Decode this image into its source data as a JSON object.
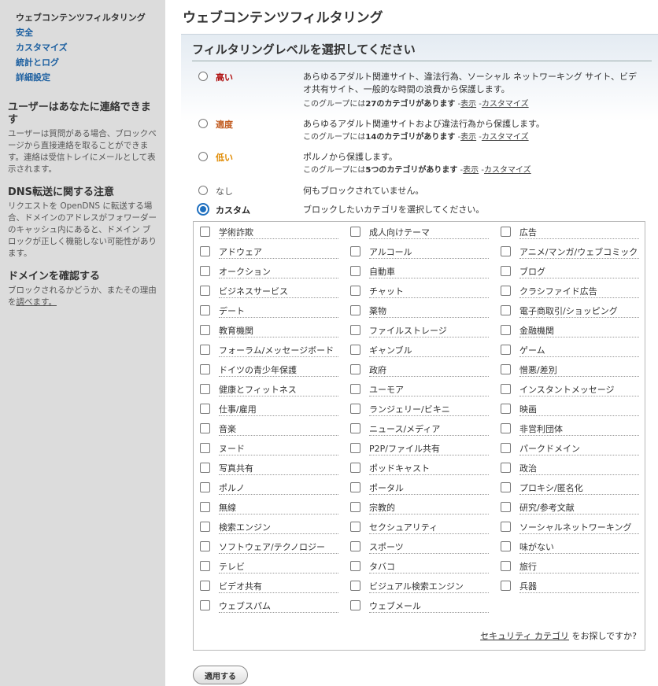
{
  "nav": {
    "items": [
      "ウェブコンテンツフィルタリング",
      "安全",
      "カスタマイズ",
      "統計とログ",
      "詳細設定"
    ]
  },
  "sidebar": {
    "contact_title": "ユーザーはあなたに連絡できます",
    "contact_text": "ユーザーは質問がある場合、ブロックページから直接連絡を取ることができます。連絡は受信トレイにメールとして表示されます。",
    "dns_title": "DNS転送に関する注意",
    "dns_text": "リクエストを OpenDNS に転送する場合、ドメインのアドレスがフォワーダーのキャッシュ内にあると、ドメイン ブロックが正しく機能しない可能性があります。",
    "check_title": "ドメインを確認する",
    "check_text": "ブロックされるかどうか、またその理由を",
    "check_link": "調べます。"
  },
  "main": {
    "page_title": "ウェブコンテンツフィルタリング",
    "panel_title": "フィルタリングレベルを選択してください"
  },
  "levels": {
    "high": {
      "name": "高い",
      "desc": "あらゆるアダルト関連サイト、違法行為、ソーシャル ネットワーキング サイト、ビデオ共有サイト、一般的な時間の浪費から保護します。",
      "meta_prefix": "このグループには",
      "meta_count": "27のカテゴリがあります",
      "view": "表示",
      "customize": "カスタマイズ"
    },
    "moderate": {
      "name": "適度",
      "desc": "あらゆるアダルト関連サイトおよび違法行為から保護します。",
      "meta_prefix": "このグループには",
      "meta_count": "14のカテゴリがあります",
      "view": "表示",
      "customize": "カスタマイズ"
    },
    "low": {
      "name": "低い",
      "desc": "ポルノから保護します。",
      "meta_prefix": "このグループには",
      "meta_count": "5つのカテゴリがあります",
      "view": "表示",
      "customize": "カスタマイズ"
    },
    "none": {
      "name": "なし",
      "desc": "何もブロックされていません。"
    },
    "custom": {
      "name": "カスタム",
      "desc": "ブロックしたいカテゴリを選択してください。"
    }
  },
  "categories": [
    "学術詐欺",
    "成人向けテーマ",
    "広告",
    "アドウェア",
    "アルコール",
    "アニメ/マンガ/ウェブコミック",
    "オークション",
    "自動車",
    "ブログ",
    "ビジネスサービス",
    "チャット",
    "クラシファイド広告",
    "デート",
    "薬物",
    "電子商取引/ショッピング",
    "教育機関",
    "ファイルストレージ",
    "金融機関",
    "フォーラム/メッセージボード",
    "ギャンブル",
    "ゲーム",
    "ドイツの青少年保護",
    "政府",
    "憎悪/差別",
    "健康とフィットネス",
    "ユーモア",
    "インスタントメッセージ",
    "仕事/雇用",
    "ランジェリー/ビキニ",
    "映画",
    "音楽",
    "ニュース/メディア",
    "非営利団体",
    "ヌード",
    "P2P/ファイル共有",
    "パークドメイン",
    "写真共有",
    "ポッドキャスト",
    "政治",
    "ポルノ",
    "ポータル",
    "プロキシ/匿名化",
    "無線",
    "宗教的",
    "研究/参考文献",
    "検索エンジン",
    "セクシュアリティ",
    "ソーシャルネットワーキング",
    "ソフトウェア/テクノロジー",
    "スポーツ",
    "味がない",
    "テレビ",
    "タバコ",
    "旅行",
    "ビデオ共有",
    "ビジュアル検索エンジン",
    "兵器",
    "ウェブスパム",
    "ウェブメール"
  ],
  "footnote": {
    "link": "セキュリティ カテゴリ",
    "suffix": "をお探しですか?"
  },
  "apply_label": "適用する"
}
